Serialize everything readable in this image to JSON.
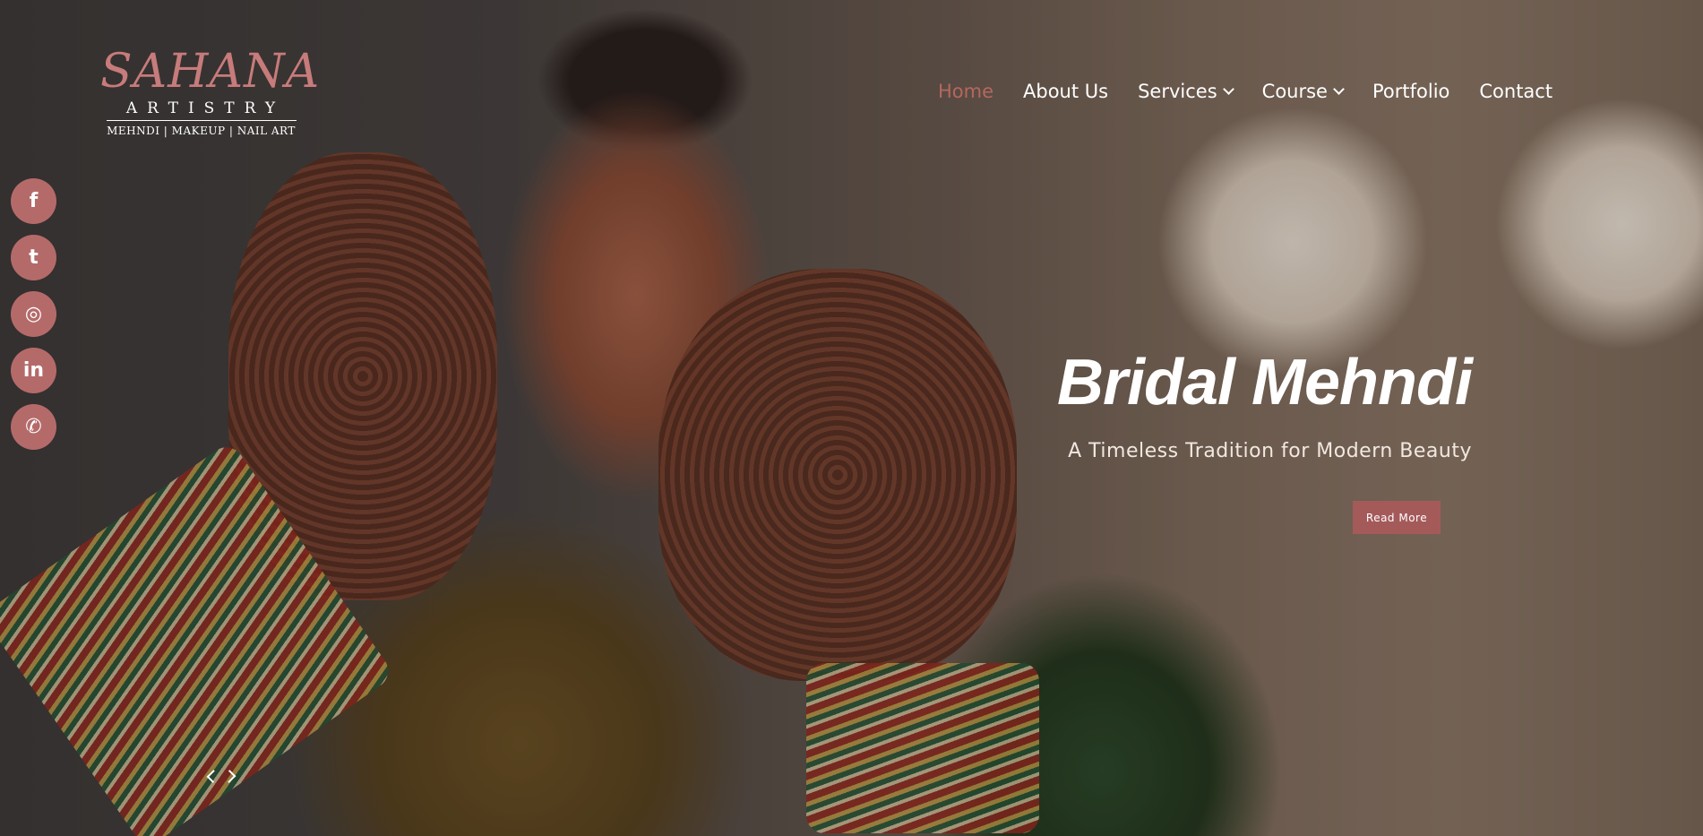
{
  "logo": {
    "main": "SAHANA",
    "sub": "ARTISTRY",
    "tagline": "MEHNDI | MAKEUP | NAIL ART"
  },
  "nav": {
    "items": [
      {
        "label": "Home",
        "active": true,
        "has_dropdown": false
      },
      {
        "label": "About Us",
        "active": false,
        "has_dropdown": false
      },
      {
        "label": "Services",
        "active": false,
        "has_dropdown": true
      },
      {
        "label": "Course",
        "active": false,
        "has_dropdown": true
      },
      {
        "label": "Portfolio",
        "active": false,
        "has_dropdown": false
      },
      {
        "label": "Contact",
        "active": false,
        "has_dropdown": false
      }
    ]
  },
  "social": {
    "icons": [
      "facebook-icon",
      "twitter-icon",
      "instagram-icon",
      "linkedin-icon",
      "whatsapp-icon"
    ],
    "glyphs": [
      "f",
      "t",
      "◎",
      "in",
      "✆"
    ]
  },
  "hero": {
    "title": "Bridal Mehndi",
    "subtitle": "A Timeless Tradition for Modern Beauty",
    "button": "Read More"
  },
  "colors": {
    "accent": "#b56a6a",
    "button": "#a55a5a",
    "active_nav": "#b5675f"
  }
}
